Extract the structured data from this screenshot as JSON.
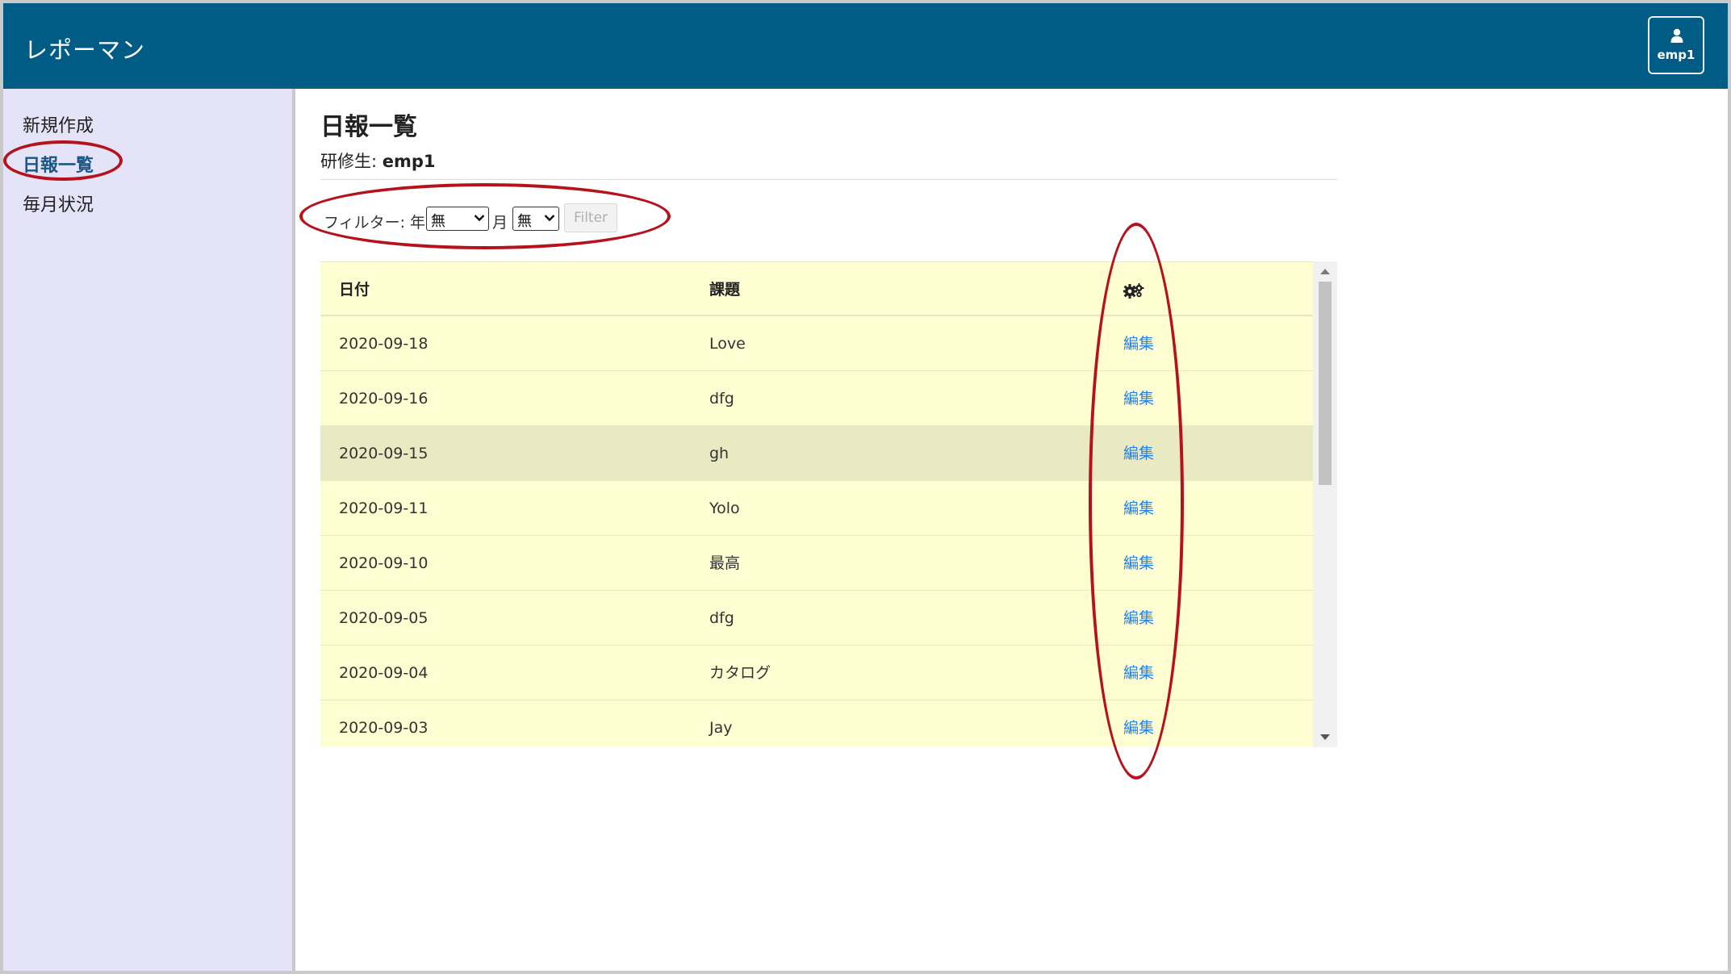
{
  "header": {
    "brand": "レポーマン",
    "user_name": "emp1"
  },
  "sidebar": {
    "items": [
      {
        "label": "新規作成",
        "active": false
      },
      {
        "label": "日報一覧",
        "active": true
      },
      {
        "label": "毎月状況",
        "active": false
      }
    ]
  },
  "main": {
    "title": "日報一覧",
    "trainee_label": "研修生:",
    "trainee_name": "emp1",
    "filter": {
      "prefix": "フィルター: 年",
      "year_value": "無",
      "month_label": "月",
      "month_value": "無",
      "button_label": "Filter"
    },
    "table": {
      "headers": {
        "date": "日付",
        "subject": "課題",
        "actions_icon": "gears-icon"
      },
      "rows": [
        {
          "date": "2020-09-18",
          "subject": "Love",
          "action": "編集"
        },
        {
          "date": "2020-09-16",
          "subject": "dfg",
          "action": "編集"
        },
        {
          "date": "2020-09-15",
          "subject": "gh",
          "action": "編集"
        },
        {
          "date": "2020-09-11",
          "subject": "Yolo",
          "action": "編集"
        },
        {
          "date": "2020-09-10",
          "subject": "最高",
          "action": "編集"
        },
        {
          "date": "2020-09-05",
          "subject": "dfg",
          "action": "編集"
        },
        {
          "date": "2020-09-04",
          "subject": "カタログ",
          "action": "編集"
        },
        {
          "date": "2020-09-03",
          "subject": "Jay",
          "action": "編集"
        }
      ]
    }
  },
  "colors": {
    "header_bg": "#005c84",
    "sidebar_bg": "#e4e3f7",
    "table_bg": "#fffed3",
    "link": "#2a80e0",
    "annotation": "#b5121b"
  }
}
